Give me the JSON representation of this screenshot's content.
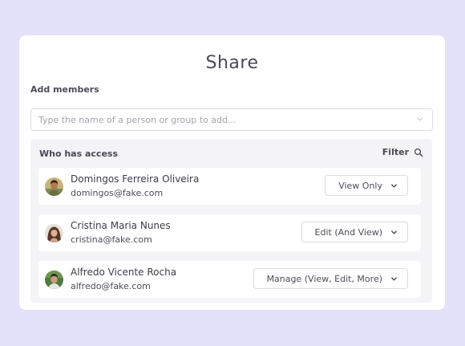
{
  "dialog": {
    "title": "Share",
    "add_members_label": "Add members",
    "search": {
      "placeholder": "Type the name of a person or group to add...",
      "value": ""
    }
  },
  "access": {
    "title": "Who has access",
    "filter_label": "Filter",
    "members": [
      {
        "name": "Domingos Ferreira Oliveira",
        "email": "domingos@fake.com",
        "role": "View Only"
      },
      {
        "name": "Cristina Maria Nunes",
        "email": "cristina@fake.com",
        "role": "Edit (And View)"
      },
      {
        "name": "Alfredo Vicente Rocha",
        "email": "alfredo@fake.com",
        "role": "Manage (View, Edit, More)"
      }
    ]
  },
  "colors": {
    "background": "#e4e1fb",
    "panel": "#f4f4f6",
    "text": "#4a4858"
  },
  "icons": {
    "search": "search-icon",
    "dropdown": "chevron-down-icon"
  }
}
